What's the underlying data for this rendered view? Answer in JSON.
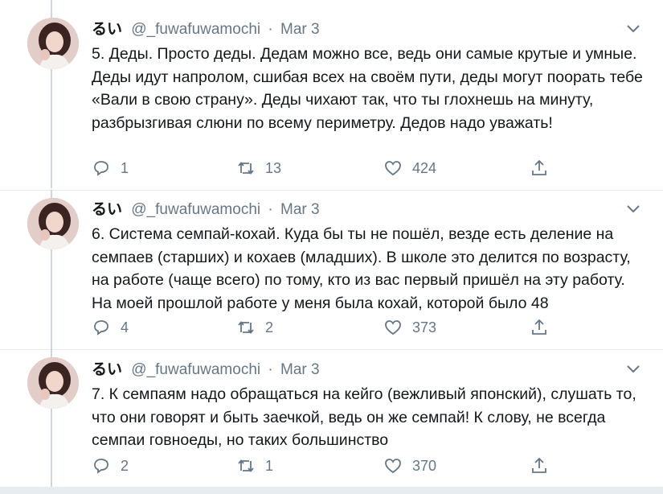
{
  "colors": {
    "text": "#14171a",
    "muted": "#657786",
    "line": "#ccd6dd",
    "border": "#e6ecf0"
  },
  "tweets": [
    {
      "name": "るい",
      "handle": "@_fuwafuwamochi",
      "sep": "·",
      "date": "Mar 3",
      "text": "5. Деды. Просто деды. Дедам можно все, ведь они самые крутые и умные. Деды идут напролом, сшибая всех на своём пути, деды могут поорать тебе «Вали в свою страну». Деды чихают так, что ты глохнешь на минуту, разбрызгивая слюни по всему периметру. Дедов надо уважать!",
      "replies": "1",
      "retweets": "13",
      "likes": "424"
    },
    {
      "name": "るい",
      "handle": "@_fuwafuwamochi",
      "sep": "·",
      "date": "Mar 3",
      "text": "6. Система семпай-кохай. Куда бы ты не пошёл, везде есть деление на семпаев (старших) и кохаев (младших). В школе это делится по возрасту, на работе (чаще всего) по тому, кто из вас первый пришёл на эту работу. На моей прошлой работе у меня была кохай, которой было 48",
      "replies": "4",
      "retweets": "2",
      "likes": "373"
    },
    {
      "name": "るい",
      "handle": "@_fuwafuwamochi",
      "sep": "·",
      "date": "Mar 3",
      "text": "7. К семпаям надо обращаться на кейго (вежливый японский), слушать то, что они говорят и быть заечкой, ведь он же семпай! К слову, не всегда семпаи говноеды, но таких большинство",
      "replies": "2",
      "retweets": "1",
      "likes": "370"
    }
  ]
}
